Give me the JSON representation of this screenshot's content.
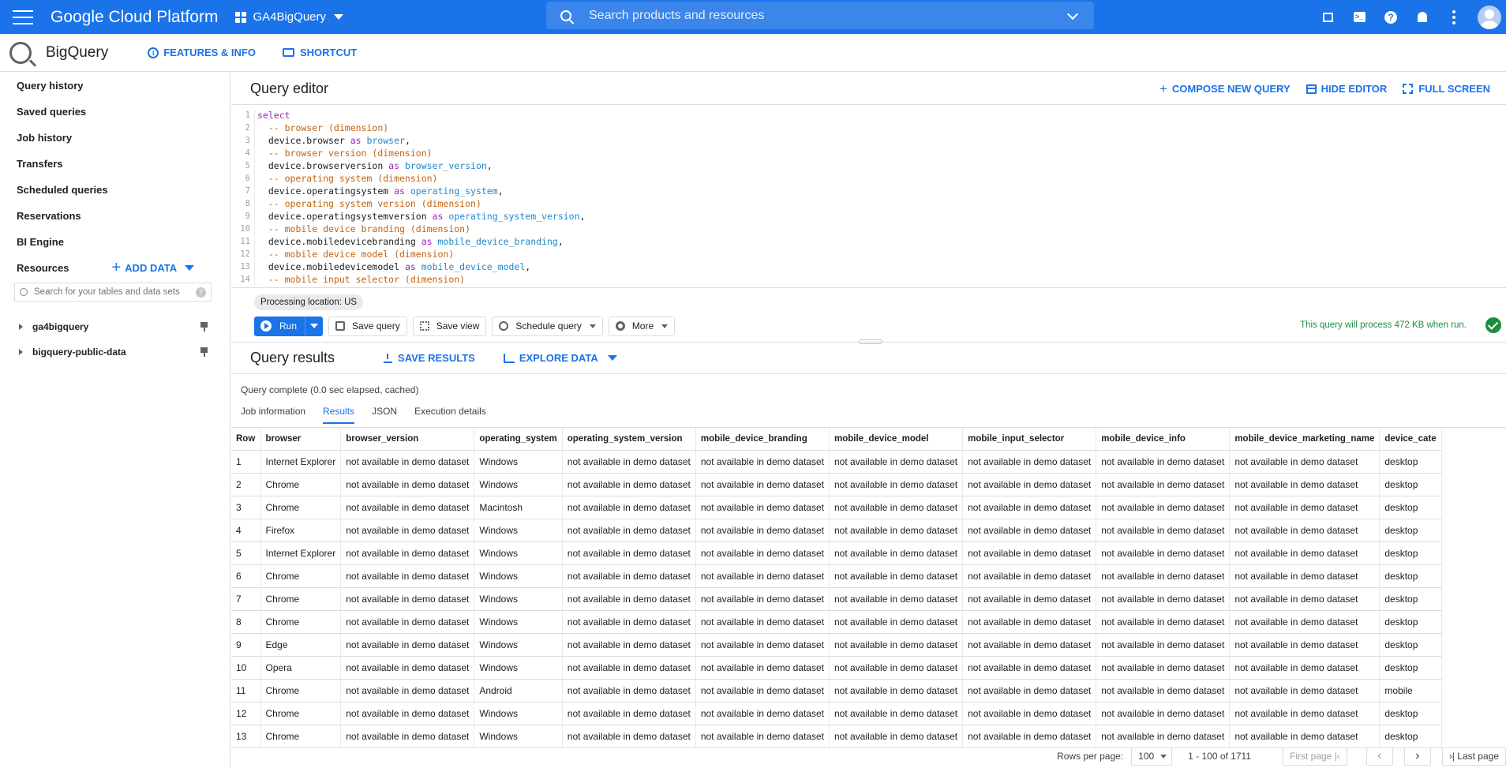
{
  "topbar": {
    "brand": "Google Cloud Platform",
    "project": "GA4BigQuery",
    "search_placeholder": "Search products and resources"
  },
  "subheader": {
    "product": "BigQuery",
    "features_label": "FEATURES & INFO",
    "shortcut_label": "SHORTCUT"
  },
  "sidebar": {
    "items": [
      "Query history",
      "Saved queries",
      "Job history",
      "Transfers",
      "Scheduled queries",
      "Reservations",
      "BI Engine"
    ],
    "resources_label": "Resources",
    "add_data_label": "ADD DATA",
    "search_placeholder": "Search for your tables and data sets",
    "projects": [
      "ga4bigquery",
      "bigquery-public-data"
    ]
  },
  "editor": {
    "title": "Query editor",
    "compose_label": "COMPOSE NEW QUERY",
    "hide_label": "HIDE EDITOR",
    "fullscreen_label": "FULL SCREEN",
    "lines": [
      {
        "n": "1",
        "parts": [
          {
            "t": "select",
            "c": "kw"
          }
        ]
      },
      {
        "n": "2",
        "parts": [
          {
            "t": "  -- browser (dimension)",
            "c": "cm"
          }
        ]
      },
      {
        "n": "3",
        "parts": [
          {
            "t": "  device.browser ",
            "c": ""
          },
          {
            "t": "as",
            "c": "kw"
          },
          {
            "t": " browser",
            "c": "al"
          },
          {
            "t": ",",
            "c": ""
          }
        ]
      },
      {
        "n": "4",
        "parts": [
          {
            "t": "  -- browser version (dimension)",
            "c": "cm"
          }
        ]
      },
      {
        "n": "5",
        "parts": [
          {
            "t": "  device.browserversion ",
            "c": ""
          },
          {
            "t": "as",
            "c": "kw"
          },
          {
            "t": " browser_version",
            "c": "al"
          },
          {
            "t": ",",
            "c": ""
          }
        ]
      },
      {
        "n": "6",
        "parts": [
          {
            "t": "  -- operating system (dimension)",
            "c": "cm"
          }
        ]
      },
      {
        "n": "7",
        "parts": [
          {
            "t": "  device.operatingsystem ",
            "c": ""
          },
          {
            "t": "as",
            "c": "kw"
          },
          {
            "t": " operating_system",
            "c": "al"
          },
          {
            "t": ",",
            "c": ""
          }
        ]
      },
      {
        "n": "8",
        "parts": [
          {
            "t": "  -- operating system version (dimension)",
            "c": "cm"
          }
        ]
      },
      {
        "n": "9",
        "parts": [
          {
            "t": "  device.operatingsystemversion ",
            "c": ""
          },
          {
            "t": "as",
            "c": "kw"
          },
          {
            "t": " operating_system_version",
            "c": "al"
          },
          {
            "t": ",",
            "c": ""
          }
        ]
      },
      {
        "n": "10",
        "parts": [
          {
            "t": "  -- mobile device branding (dimension)",
            "c": "cm"
          }
        ]
      },
      {
        "n": "11",
        "parts": [
          {
            "t": "  device.mobiledevicebranding ",
            "c": ""
          },
          {
            "t": "as",
            "c": "kw"
          },
          {
            "t": " mobile_device_branding",
            "c": "al"
          },
          {
            "t": ",",
            "c": ""
          }
        ]
      },
      {
        "n": "12",
        "parts": [
          {
            "t": "  -- mobile device model (dimension)",
            "c": "cm"
          }
        ]
      },
      {
        "n": "13",
        "parts": [
          {
            "t": "  device.mobiledevicemodel ",
            "c": ""
          },
          {
            "t": "as",
            "c": "kw"
          },
          {
            "t": " mobile_device_model",
            "c": "al"
          },
          {
            "t": ",",
            "c": ""
          }
        ]
      },
      {
        "n": "14",
        "parts": [
          {
            "t": "  -- mobile input selector (dimension)",
            "c": "cm"
          }
        ]
      }
    ]
  },
  "toolbar": {
    "processing_location": "Processing location: US",
    "run_label": "Run",
    "save_query_label": "Save query",
    "save_view_label": "Save view",
    "schedule_label": "Schedule query",
    "more_label": "More",
    "validator_text": "This query will process 472 KB when run."
  },
  "results": {
    "title": "Query results",
    "save_label": "SAVE RESULTS",
    "explore_label": "EXPLORE DATA",
    "status": "Query complete (0.0 sec elapsed, cached)",
    "tabs": [
      "Job information",
      "Results",
      "JSON",
      "Execution details"
    ],
    "columns": [
      "Row",
      "browser",
      "browser_version",
      "operating_system",
      "operating_system_version",
      "mobile_device_branding",
      "mobile_device_model",
      "mobile_input_selector",
      "mobile_device_info",
      "mobile_device_marketing_name",
      "device_cate"
    ],
    "rows": [
      [
        "1",
        "Internet Explorer",
        "Windows",
        "desktop"
      ],
      [
        "2",
        "Chrome",
        "Windows",
        "desktop"
      ],
      [
        "3",
        "Chrome",
        "Macintosh",
        "desktop"
      ],
      [
        "4",
        "Firefox",
        "Windows",
        "desktop"
      ],
      [
        "5",
        "Internet Explorer",
        "Windows",
        "desktop"
      ],
      [
        "6",
        "Chrome",
        "Windows",
        "desktop"
      ],
      [
        "7",
        "Chrome",
        "Windows",
        "desktop"
      ],
      [
        "8",
        "Chrome",
        "Windows",
        "desktop"
      ],
      [
        "9",
        "Edge",
        "Windows",
        "desktop"
      ],
      [
        "10",
        "Opera",
        "Windows",
        "desktop"
      ],
      [
        "11",
        "Chrome",
        "Android",
        "mobile"
      ],
      [
        "12",
        "Chrome",
        "Windows",
        "desktop"
      ],
      [
        "13",
        "Chrome",
        "Windows",
        "desktop"
      ]
    ],
    "na_text": "not available in demo dataset"
  },
  "pager": {
    "rows_per_page_label": "Rows per page:",
    "rows_per_page": "100",
    "range": "1 - 100 of 1711",
    "first_page": "First page",
    "last_page": "Last page"
  }
}
